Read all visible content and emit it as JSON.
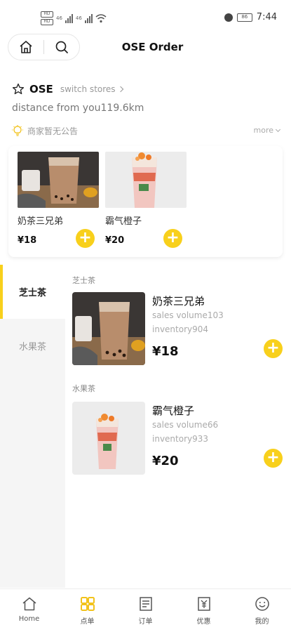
{
  "statusbar": {
    "sim1": "HD",
    "sim2": "HD",
    "signal1": "46",
    "signal2": "46",
    "battery": "86",
    "time": "7:44"
  },
  "header": {
    "title": "OSE Order"
  },
  "store": {
    "name": "OSE",
    "switch_label": "switch stores",
    "distance": "distance from you119.6km",
    "notice": "商家暂无公告",
    "more_label": "more"
  },
  "recommended": [
    {
      "name": "奶茶三兄弟",
      "price": "¥18"
    },
    {
      "name": "霸气橙子",
      "price": "¥20"
    }
  ],
  "categories": [
    {
      "label": "芝士茶",
      "active": true
    },
    {
      "label": "水果茶",
      "active": false
    }
  ],
  "sections": [
    {
      "title": "芝士茶",
      "goods": {
        "name": "奶茶三兄弟",
        "sales": "sales volume103",
        "inventory": "inventory904",
        "price": "¥18"
      }
    },
    {
      "title": "水果茶",
      "goods": {
        "name": "霸气橙子",
        "sales": "sales volume66",
        "inventory": "inventory933",
        "price": "¥20"
      }
    }
  ],
  "plus_label": "+",
  "tabbar": [
    {
      "label": "Home",
      "icon": "home-icon"
    },
    {
      "label": "点单",
      "icon": "order-grid-icon"
    },
    {
      "label": "订单",
      "icon": "receipt-icon"
    },
    {
      "label": "优惠",
      "icon": "coupon-icon"
    },
    {
      "label": "我的",
      "icon": "profile-icon"
    }
  ],
  "colors": {
    "accent": "#f8d01c",
    "muted_text": "#999999",
    "sidebar_bg": "#f5f5f5"
  }
}
